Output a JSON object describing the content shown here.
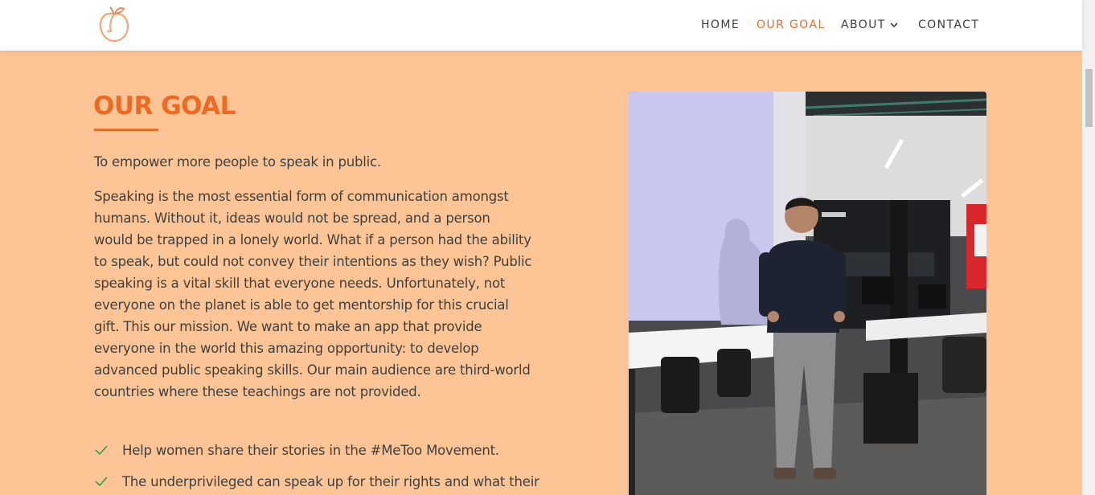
{
  "nav": {
    "items": [
      {
        "label": "HOME"
      },
      {
        "label": "OUR GOAL"
      },
      {
        "label": "ABOUT"
      },
      {
        "label": "CONTACT"
      }
    ],
    "active_color": "#ee6a23",
    "logo_icon": "peach-logo-icon"
  },
  "goal": {
    "heading": "OUR GOAL",
    "intro": "To empower more people to speak in public.",
    "body": "Speaking is the most essential form of communication amongst humans. Without it, ideas would not be spread, and a person would be trapped in a lonely world. What if a person had the ability to speak, but could not convey their intentions as they wish? Public speaking is a vital skill that everyone needs. Unfortunately, not everyone on the planet is able to get mentorship for this crucial gift. This our mission. We want to make an app that provide everyone in the world this amazing opportunity: to develop advanced public speaking skills. Our main audience are third-world countries where these teachings are not provided.",
    "list": [
      "Help women share their stories in the #MeToo Movement.",
      "The underprivileged can speak up for their rights and what their"
    ]
  },
  "colors": {
    "background": "#fdc595",
    "accent": "#ee6a23",
    "check": "#3fa34d"
  }
}
